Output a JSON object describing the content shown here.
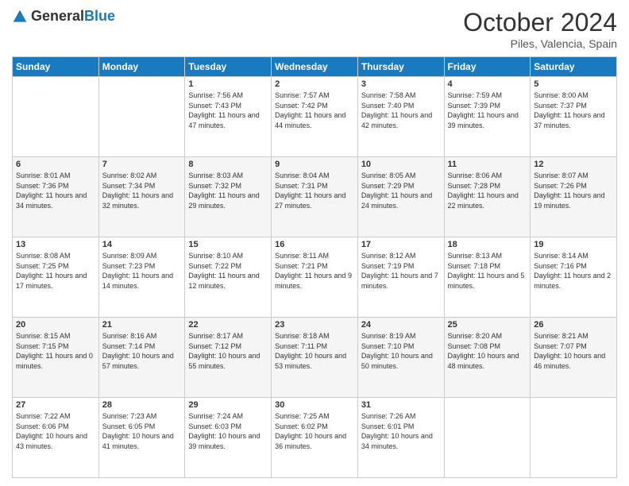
{
  "header": {
    "logo_general": "General",
    "logo_blue": "Blue",
    "month": "October 2024",
    "location": "Piles, Valencia, Spain"
  },
  "weekdays": [
    "Sunday",
    "Monday",
    "Tuesday",
    "Wednesday",
    "Thursday",
    "Friday",
    "Saturday"
  ],
  "weeks": [
    [
      {
        "day": "",
        "sunrise": "",
        "sunset": "",
        "daylight": ""
      },
      {
        "day": "",
        "sunrise": "",
        "sunset": "",
        "daylight": ""
      },
      {
        "day": "1",
        "sunrise": "Sunrise: 7:56 AM",
        "sunset": "Sunset: 7:43 PM",
        "daylight": "Daylight: 11 hours and 47 minutes."
      },
      {
        "day": "2",
        "sunrise": "Sunrise: 7:57 AM",
        "sunset": "Sunset: 7:42 PM",
        "daylight": "Daylight: 11 hours and 44 minutes."
      },
      {
        "day": "3",
        "sunrise": "Sunrise: 7:58 AM",
        "sunset": "Sunset: 7:40 PM",
        "daylight": "Daylight: 11 hours and 42 minutes."
      },
      {
        "day": "4",
        "sunrise": "Sunrise: 7:59 AM",
        "sunset": "Sunset: 7:39 PM",
        "daylight": "Daylight: 11 hours and 39 minutes."
      },
      {
        "day": "5",
        "sunrise": "Sunrise: 8:00 AM",
        "sunset": "Sunset: 7:37 PM",
        "daylight": "Daylight: 11 hours and 37 minutes."
      }
    ],
    [
      {
        "day": "6",
        "sunrise": "Sunrise: 8:01 AM",
        "sunset": "Sunset: 7:36 PM",
        "daylight": "Daylight: 11 hours and 34 minutes."
      },
      {
        "day": "7",
        "sunrise": "Sunrise: 8:02 AM",
        "sunset": "Sunset: 7:34 PM",
        "daylight": "Daylight: 11 hours and 32 minutes."
      },
      {
        "day": "8",
        "sunrise": "Sunrise: 8:03 AM",
        "sunset": "Sunset: 7:32 PM",
        "daylight": "Daylight: 11 hours and 29 minutes."
      },
      {
        "day": "9",
        "sunrise": "Sunrise: 8:04 AM",
        "sunset": "Sunset: 7:31 PM",
        "daylight": "Daylight: 11 hours and 27 minutes."
      },
      {
        "day": "10",
        "sunrise": "Sunrise: 8:05 AM",
        "sunset": "Sunset: 7:29 PM",
        "daylight": "Daylight: 11 hours and 24 minutes."
      },
      {
        "day": "11",
        "sunrise": "Sunrise: 8:06 AM",
        "sunset": "Sunset: 7:28 PM",
        "daylight": "Daylight: 11 hours and 22 minutes."
      },
      {
        "day": "12",
        "sunrise": "Sunrise: 8:07 AM",
        "sunset": "Sunset: 7:26 PM",
        "daylight": "Daylight: 11 hours and 19 minutes."
      }
    ],
    [
      {
        "day": "13",
        "sunrise": "Sunrise: 8:08 AM",
        "sunset": "Sunset: 7:25 PM",
        "daylight": "Daylight: 11 hours and 17 minutes."
      },
      {
        "day": "14",
        "sunrise": "Sunrise: 8:09 AM",
        "sunset": "Sunset: 7:23 PM",
        "daylight": "Daylight: 11 hours and 14 minutes."
      },
      {
        "day": "15",
        "sunrise": "Sunrise: 8:10 AM",
        "sunset": "Sunset: 7:22 PM",
        "daylight": "Daylight: 11 hours and 12 minutes."
      },
      {
        "day": "16",
        "sunrise": "Sunrise: 8:11 AM",
        "sunset": "Sunset: 7:21 PM",
        "daylight": "Daylight: 11 hours and 9 minutes."
      },
      {
        "day": "17",
        "sunrise": "Sunrise: 8:12 AM",
        "sunset": "Sunset: 7:19 PM",
        "daylight": "Daylight: 11 hours and 7 minutes."
      },
      {
        "day": "18",
        "sunrise": "Sunrise: 8:13 AM",
        "sunset": "Sunset: 7:18 PM",
        "daylight": "Daylight: 11 hours and 5 minutes."
      },
      {
        "day": "19",
        "sunrise": "Sunrise: 8:14 AM",
        "sunset": "Sunset: 7:16 PM",
        "daylight": "Daylight: 11 hours and 2 minutes."
      }
    ],
    [
      {
        "day": "20",
        "sunrise": "Sunrise: 8:15 AM",
        "sunset": "Sunset: 7:15 PM",
        "daylight": "Daylight: 11 hours and 0 minutes."
      },
      {
        "day": "21",
        "sunrise": "Sunrise: 8:16 AM",
        "sunset": "Sunset: 7:14 PM",
        "daylight": "Daylight: 10 hours and 57 minutes."
      },
      {
        "day": "22",
        "sunrise": "Sunrise: 8:17 AM",
        "sunset": "Sunset: 7:12 PM",
        "daylight": "Daylight: 10 hours and 55 minutes."
      },
      {
        "day": "23",
        "sunrise": "Sunrise: 8:18 AM",
        "sunset": "Sunset: 7:11 PM",
        "daylight": "Daylight: 10 hours and 53 minutes."
      },
      {
        "day": "24",
        "sunrise": "Sunrise: 8:19 AM",
        "sunset": "Sunset: 7:10 PM",
        "daylight": "Daylight: 10 hours and 50 minutes."
      },
      {
        "day": "25",
        "sunrise": "Sunrise: 8:20 AM",
        "sunset": "Sunset: 7:08 PM",
        "daylight": "Daylight: 10 hours and 48 minutes."
      },
      {
        "day": "26",
        "sunrise": "Sunrise: 8:21 AM",
        "sunset": "Sunset: 7:07 PM",
        "daylight": "Daylight: 10 hours and 46 minutes."
      }
    ],
    [
      {
        "day": "27",
        "sunrise": "Sunrise: 7:22 AM",
        "sunset": "Sunset: 6:06 PM",
        "daylight": "Daylight: 10 hours and 43 minutes."
      },
      {
        "day": "28",
        "sunrise": "Sunrise: 7:23 AM",
        "sunset": "Sunset: 6:05 PM",
        "daylight": "Daylight: 10 hours and 41 minutes."
      },
      {
        "day": "29",
        "sunrise": "Sunrise: 7:24 AM",
        "sunset": "Sunset: 6:03 PM",
        "daylight": "Daylight: 10 hours and 39 minutes."
      },
      {
        "day": "30",
        "sunrise": "Sunrise: 7:25 AM",
        "sunset": "Sunset: 6:02 PM",
        "daylight": "Daylight: 10 hours and 36 minutes."
      },
      {
        "day": "31",
        "sunrise": "Sunrise: 7:26 AM",
        "sunset": "Sunset: 6:01 PM",
        "daylight": "Daylight: 10 hours and 34 minutes."
      },
      {
        "day": "",
        "sunrise": "",
        "sunset": "",
        "daylight": ""
      },
      {
        "day": "",
        "sunrise": "",
        "sunset": "",
        "daylight": ""
      }
    ]
  ]
}
